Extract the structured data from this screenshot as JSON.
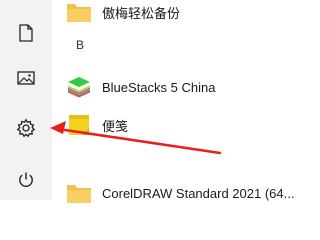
{
  "rail": {
    "items": [
      {
        "name": "document-icon"
      },
      {
        "name": "pictures-icon"
      },
      {
        "name": "settings-icon"
      },
      {
        "name": "power-icon"
      }
    ]
  },
  "list": {
    "items": [
      {
        "type": "folder",
        "label": "傲梅轻松备份"
      },
      {
        "type": "header",
        "label": "B"
      },
      {
        "type": "app",
        "label": "BlueStacks 5 China"
      },
      {
        "type": "app",
        "label": "便笺"
      },
      {
        "type": "folder",
        "label": "CorelDRAW Standard 2021 (64..."
      }
    ]
  },
  "colors": {
    "rail_bg": "#f2f2f2",
    "annotation_arrow": "#e8201a",
    "folder": "#f5c04a",
    "sticky_note": "#f4d21f"
  }
}
